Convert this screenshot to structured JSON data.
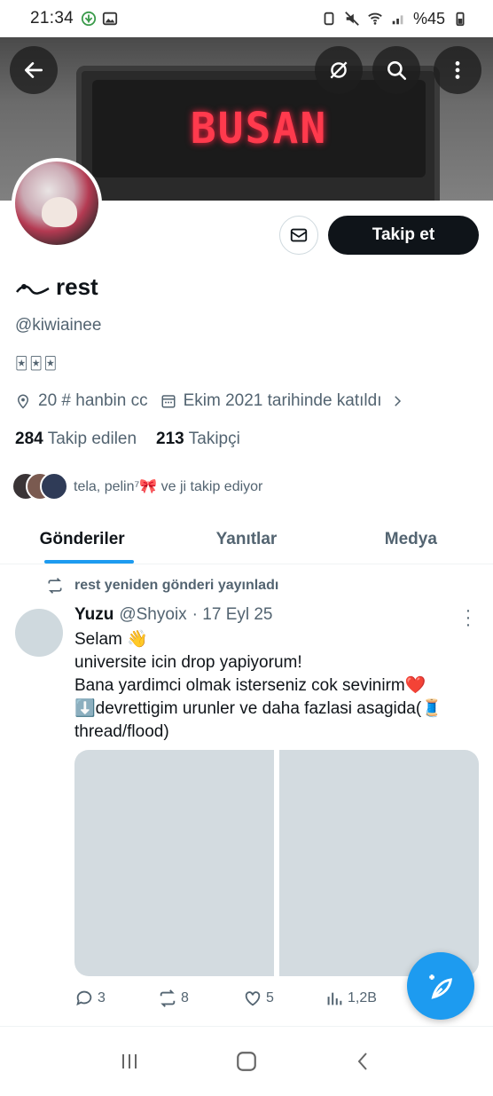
{
  "status_bar": {
    "time": "21:34",
    "battery": "%45"
  },
  "banner": {
    "led_text": "BUSAN"
  },
  "profile": {
    "display_name": "rest",
    "handle": "@kiwiainee",
    "bio": "🃏🃏🃏",
    "location": "20 # hanbin cc",
    "joined": "Ekim 2021 tarihinde katıldı",
    "following_count": "284",
    "following_label": "Takip edilen",
    "followers_count": "213",
    "followers_label": "Takipçi",
    "followed_by": "tela, pelin⁷🎀 ve ji takip ediyor",
    "follow_button": "Takip et"
  },
  "tabs": [
    {
      "label": "Gönderiler",
      "active": true
    },
    {
      "label": "Yanıtlar",
      "active": false
    },
    {
      "label": "Medya",
      "active": false
    }
  ],
  "repost_line": "rest yeniden gönderi yayınladı",
  "tweet": {
    "name": "Yuzu",
    "handle": "@Shyoix",
    "date": "· 17 Eyl 25",
    "body": "Selam 👋\nuniversite icin drop yapiyorum!\nBana yardimci olmak isterseniz cok sevinirm❤️\n⬇️devrettigim urunler ve daha fazlasi asagida(🧵thread/flood)",
    "replies": "3",
    "reposts": "8",
    "likes": "5",
    "views": "1,2B"
  },
  "colors": {
    "accent": "#1d9bf0",
    "text_primary": "#0f1419",
    "text_secondary": "#536471",
    "follow_button_bg": "#0f1419",
    "placeholder": "#d3dbe0",
    "led": "#ff3a4d"
  },
  "icons": {
    "back": "arrow-left-icon",
    "translate": "no-translate-icon",
    "search": "search-icon",
    "more": "more-vertical-icon",
    "message": "envelope-icon",
    "location": "location-pin-icon",
    "calendar": "calendar-icon",
    "repost": "repost-icon",
    "reply": "reply-icon",
    "like": "heart-icon",
    "views": "views-icon",
    "compose": "compose-feather-icon"
  }
}
